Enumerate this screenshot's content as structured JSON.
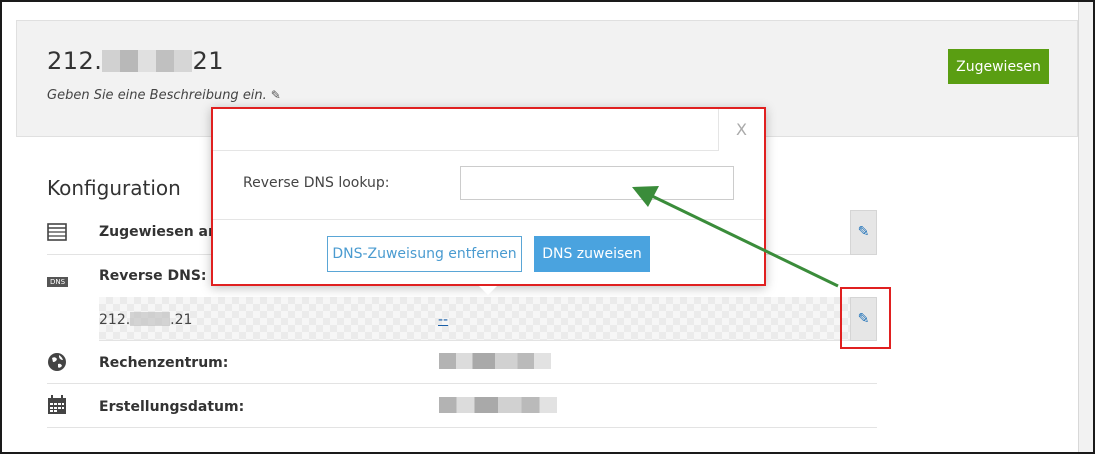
{
  "header": {
    "ip_prefix": "212.",
    "ip_suffix": "21",
    "description": "Geben Sie eine Beschreibung ein.",
    "status_button": "Zugewiesen"
  },
  "config": {
    "title": "Konfiguration",
    "rows": {
      "assigned": {
        "label": "Zugewiesen an:",
        "icon": "server-icon"
      },
      "reverse_dns": {
        "label": "Reverse DNS:",
        "icon_text": "DNS",
        "ip_prefix": "212.",
        "ip_suffix": ".21",
        "value": "--"
      },
      "datacenter": {
        "label": "Rechenzentrum:",
        "icon": "globe-icon"
      },
      "created": {
        "label": "Erstellungsdatum:",
        "icon": "calendar-icon"
      }
    }
  },
  "modal": {
    "close": "X",
    "field_label": "Reverse DNS lookup:",
    "field_value": "",
    "remove_button": "DNS-Zuweisung entfernen",
    "assign_button": "DNS zuweisen"
  },
  "colors": {
    "accent_green": "#5a9e12",
    "accent_blue": "#4aa3df",
    "annotation_red": "#e02020",
    "annotation_arrow": "#3a8c3a"
  }
}
